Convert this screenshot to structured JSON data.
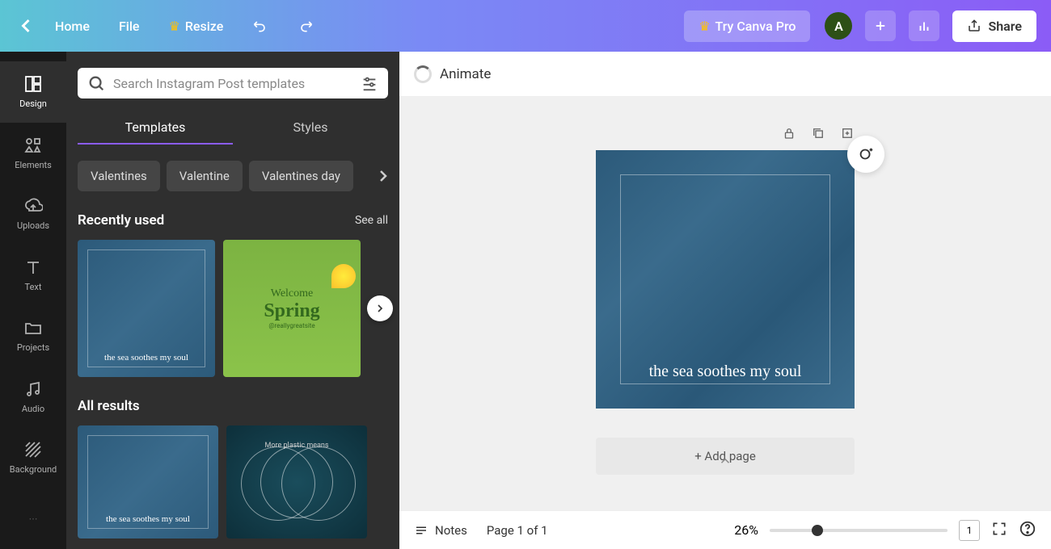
{
  "header": {
    "home": "Home",
    "file": "File",
    "resize": "Resize",
    "try_pro": "Try Canva Pro",
    "avatar_initial": "A",
    "share": "Share"
  },
  "rail": {
    "design": "Design",
    "elements": "Elements",
    "uploads": "Uploads",
    "text": "Text",
    "projects": "Projects",
    "audio": "Audio",
    "background": "Background"
  },
  "panel": {
    "search_placeholder": "Search Instagram Post templates",
    "tabs": {
      "templates": "Templates",
      "styles": "Styles"
    },
    "chips": [
      "Valentines",
      "Valentine",
      "Valentines day"
    ],
    "recent": {
      "title": "Recently used",
      "see_all": "See all"
    },
    "all_results": "All results",
    "thumb_sea_text": "the sea soothes my soul",
    "thumb_spring_t1": "Welcome",
    "thumb_spring_t2": "Spring",
    "thumb_spring_t3": "@reallygreatsite",
    "thumb_plastic": "More plastic means"
  },
  "canvas": {
    "animate": "Animate",
    "artboard_text": "the sea soothes my soul",
    "add_page": "+ Add page"
  },
  "footer": {
    "notes": "Notes",
    "page_info": "Page 1 of 1",
    "zoom": "26%",
    "page_num": "1"
  }
}
